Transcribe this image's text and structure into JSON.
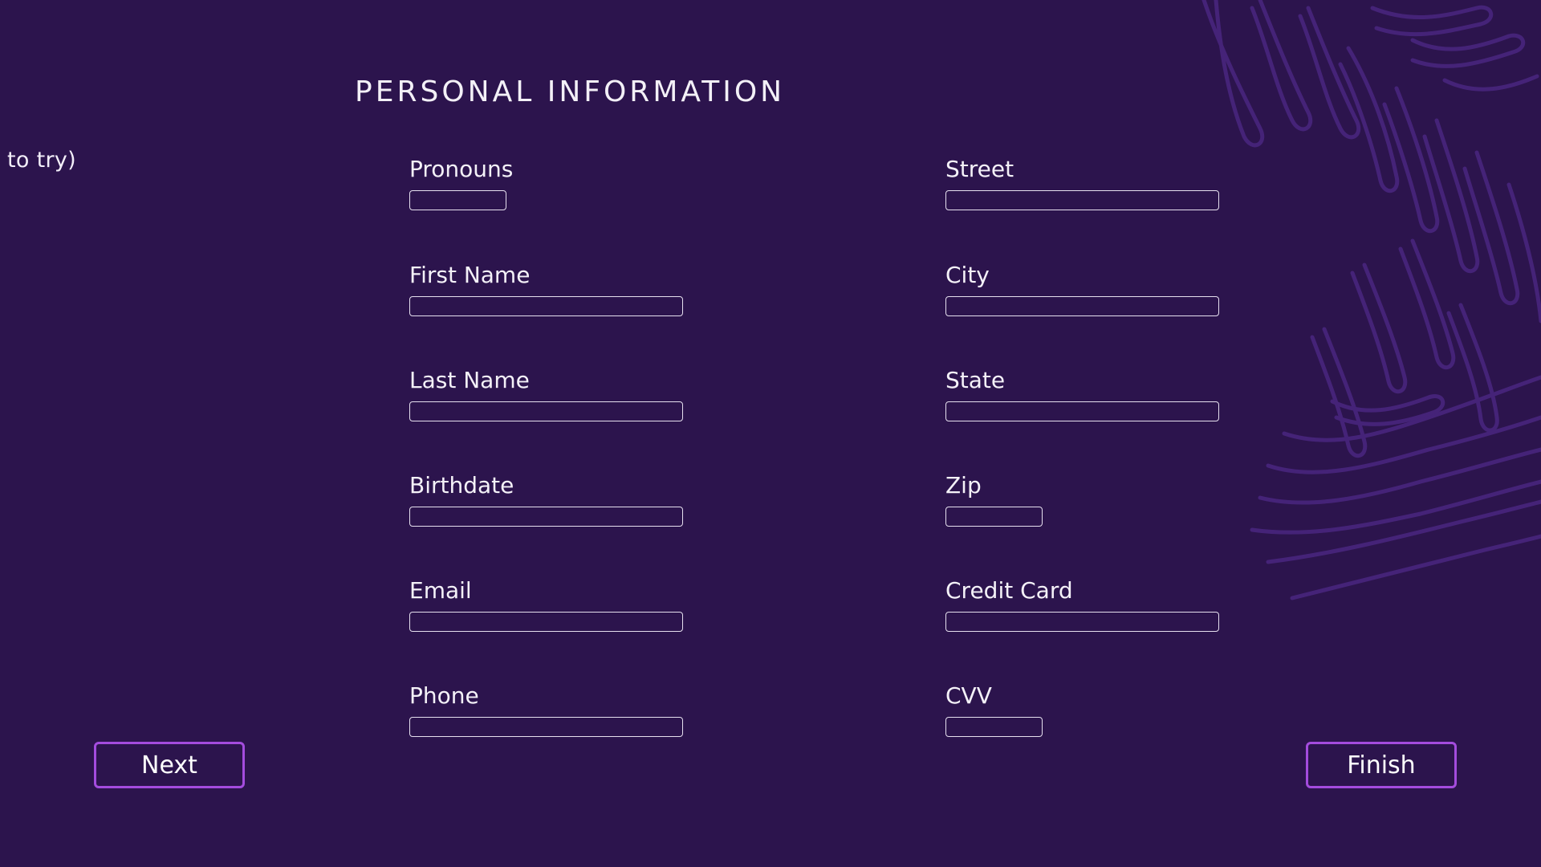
{
  "page": {
    "side_text": "to try)",
    "title": "PERSONAL INFORMATION"
  },
  "form": {
    "left_column": [
      {
        "label": "Pronouns",
        "value": ""
      },
      {
        "label": "First Name",
        "value": ""
      },
      {
        "label": "Last Name",
        "value": ""
      },
      {
        "label": "Birthdate",
        "value": ""
      },
      {
        "label": "Email",
        "value": ""
      },
      {
        "label": "Phone",
        "value": ""
      }
    ],
    "right_column": [
      {
        "label": "Street",
        "value": ""
      },
      {
        "label": "City",
        "value": ""
      },
      {
        "label": "State",
        "value": ""
      },
      {
        "label": "Zip",
        "value": ""
      },
      {
        "label": "Credit Card",
        "value": ""
      },
      {
        "label": "CVV",
        "value": ""
      }
    ]
  },
  "buttons": {
    "next_label": "Next",
    "finish_label": "Finish"
  },
  "colors": {
    "background": "#2c144d",
    "accent": "#a44cde",
    "decoration": "#4a2680"
  }
}
